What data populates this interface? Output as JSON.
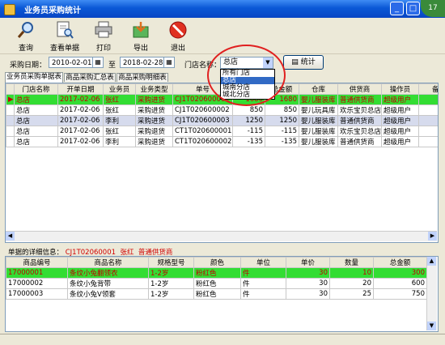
{
  "window": {
    "title": "业务员采购统计",
    "badge": "17"
  },
  "toolbar": {
    "query": "查询",
    "view_doc": "查看单据",
    "print": "打印",
    "export": "导出",
    "exit": "退出"
  },
  "filter": {
    "date_label": "采购日期：",
    "date_from": "2010-02-01",
    "to_label": "至",
    "date_to": "2018-02-28",
    "store_label": "门店名称：",
    "store_value": "总店",
    "stat_button": "统计",
    "store_options": [
      "所有门店",
      "总店",
      "城南分店",
      "城北分店"
    ],
    "store_highlighted": "总店"
  },
  "tabs": [
    "业务员采购单据表",
    "商品采购汇总表",
    "商品采购明细表"
  ],
  "main_table": {
    "columns": [
      "门店名称",
      "开单日期",
      "业务员",
      "业务类型",
      "单号",
      "数量",
      "总金额",
      "仓库",
      "供货商",
      "操作员",
      "备注"
    ],
    "rows": [
      [
        "总店",
        "2017-02-06",
        "张红",
        "采购进货",
        "CJ1T020600001",
        "1680",
        "1680",
        "婴儿服装库",
        "普通供货商",
        "超级用户",
        ""
      ],
      [
        "总店",
        "2017-02-06",
        "张红",
        "采购进货",
        "CJ1T020600002",
        "850",
        "850",
        "婴儿玩具库",
        "欢乐宝贝总店",
        "超级用户",
        ""
      ],
      [
        "总店",
        "2017-02-06",
        "李利",
        "采购进货",
        "CJ1T020600003",
        "1250",
        "1250",
        "婴儿服装库",
        "普通供货商",
        "超级用户",
        ""
      ],
      [
        "总店",
        "2017-02-06",
        "张红",
        "采购退货",
        "CT1T020600001",
        "-115",
        "-115",
        "婴儿服装库",
        "欢乐宝贝总店",
        "超级用户",
        ""
      ],
      [
        "总店",
        "2017-02-06",
        "李利",
        "采购退货",
        "CT1T020600002",
        "-135",
        "-135",
        "婴儿服装库",
        "普通供货商",
        "超级用户",
        ""
      ]
    ]
  },
  "detail": {
    "label": "单据的详细信息：",
    "doc_no": "CJ1T02060001",
    "salesman": "张红",
    "supplier": "普通供货商",
    "columns": [
      "商品编号",
      "商品名称",
      "规格型号",
      "颜色",
      "单位",
      "单价",
      "数量",
      "总金额"
    ],
    "rows": [
      [
        "17000001",
        "条纹小兔翻领衣",
        "1-2岁",
        "粉红色",
        "件",
        "30",
        "10",
        "300"
      ],
      [
        "17000002",
        "条纹小兔背带",
        "1-2岁",
        "粉红色",
        "件",
        "30",
        "20",
        "600"
      ],
      [
        "17000003",
        "条纹小兔V领套",
        "1-2岁",
        "粉红色",
        "件",
        "30",
        "25",
        "750"
      ]
    ]
  }
}
